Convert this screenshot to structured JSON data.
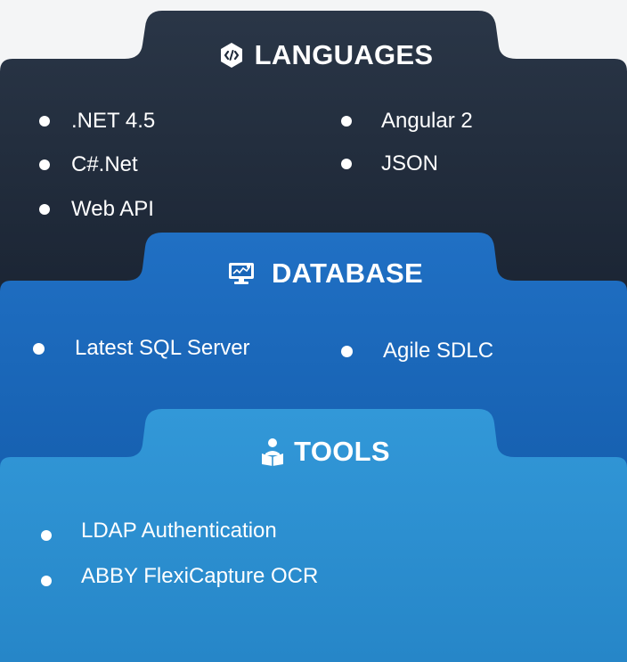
{
  "layers": {
    "languages": {
      "title": "LANGUAGES",
      "icon": "code-icon",
      "color": "#1f2a3a",
      "items_left": [
        ".NET 4.5",
        "C#.Net",
        "Web API"
      ],
      "items_right": [
        "Angular 2",
        "JSON"
      ]
    },
    "database": {
      "title": "DATABASE",
      "icon": "database-monitor-icon",
      "color": "#1a66b8",
      "items": [
        "Latest SQL Server",
        "Agile SDLC"
      ]
    },
    "tools": {
      "title": "TOOLS",
      "icon": "reader-icon",
      "color": "#2a8fd0",
      "items": [
        "LDAP Authentication",
        "ABBY FlexiCapture OCR"
      ]
    }
  }
}
